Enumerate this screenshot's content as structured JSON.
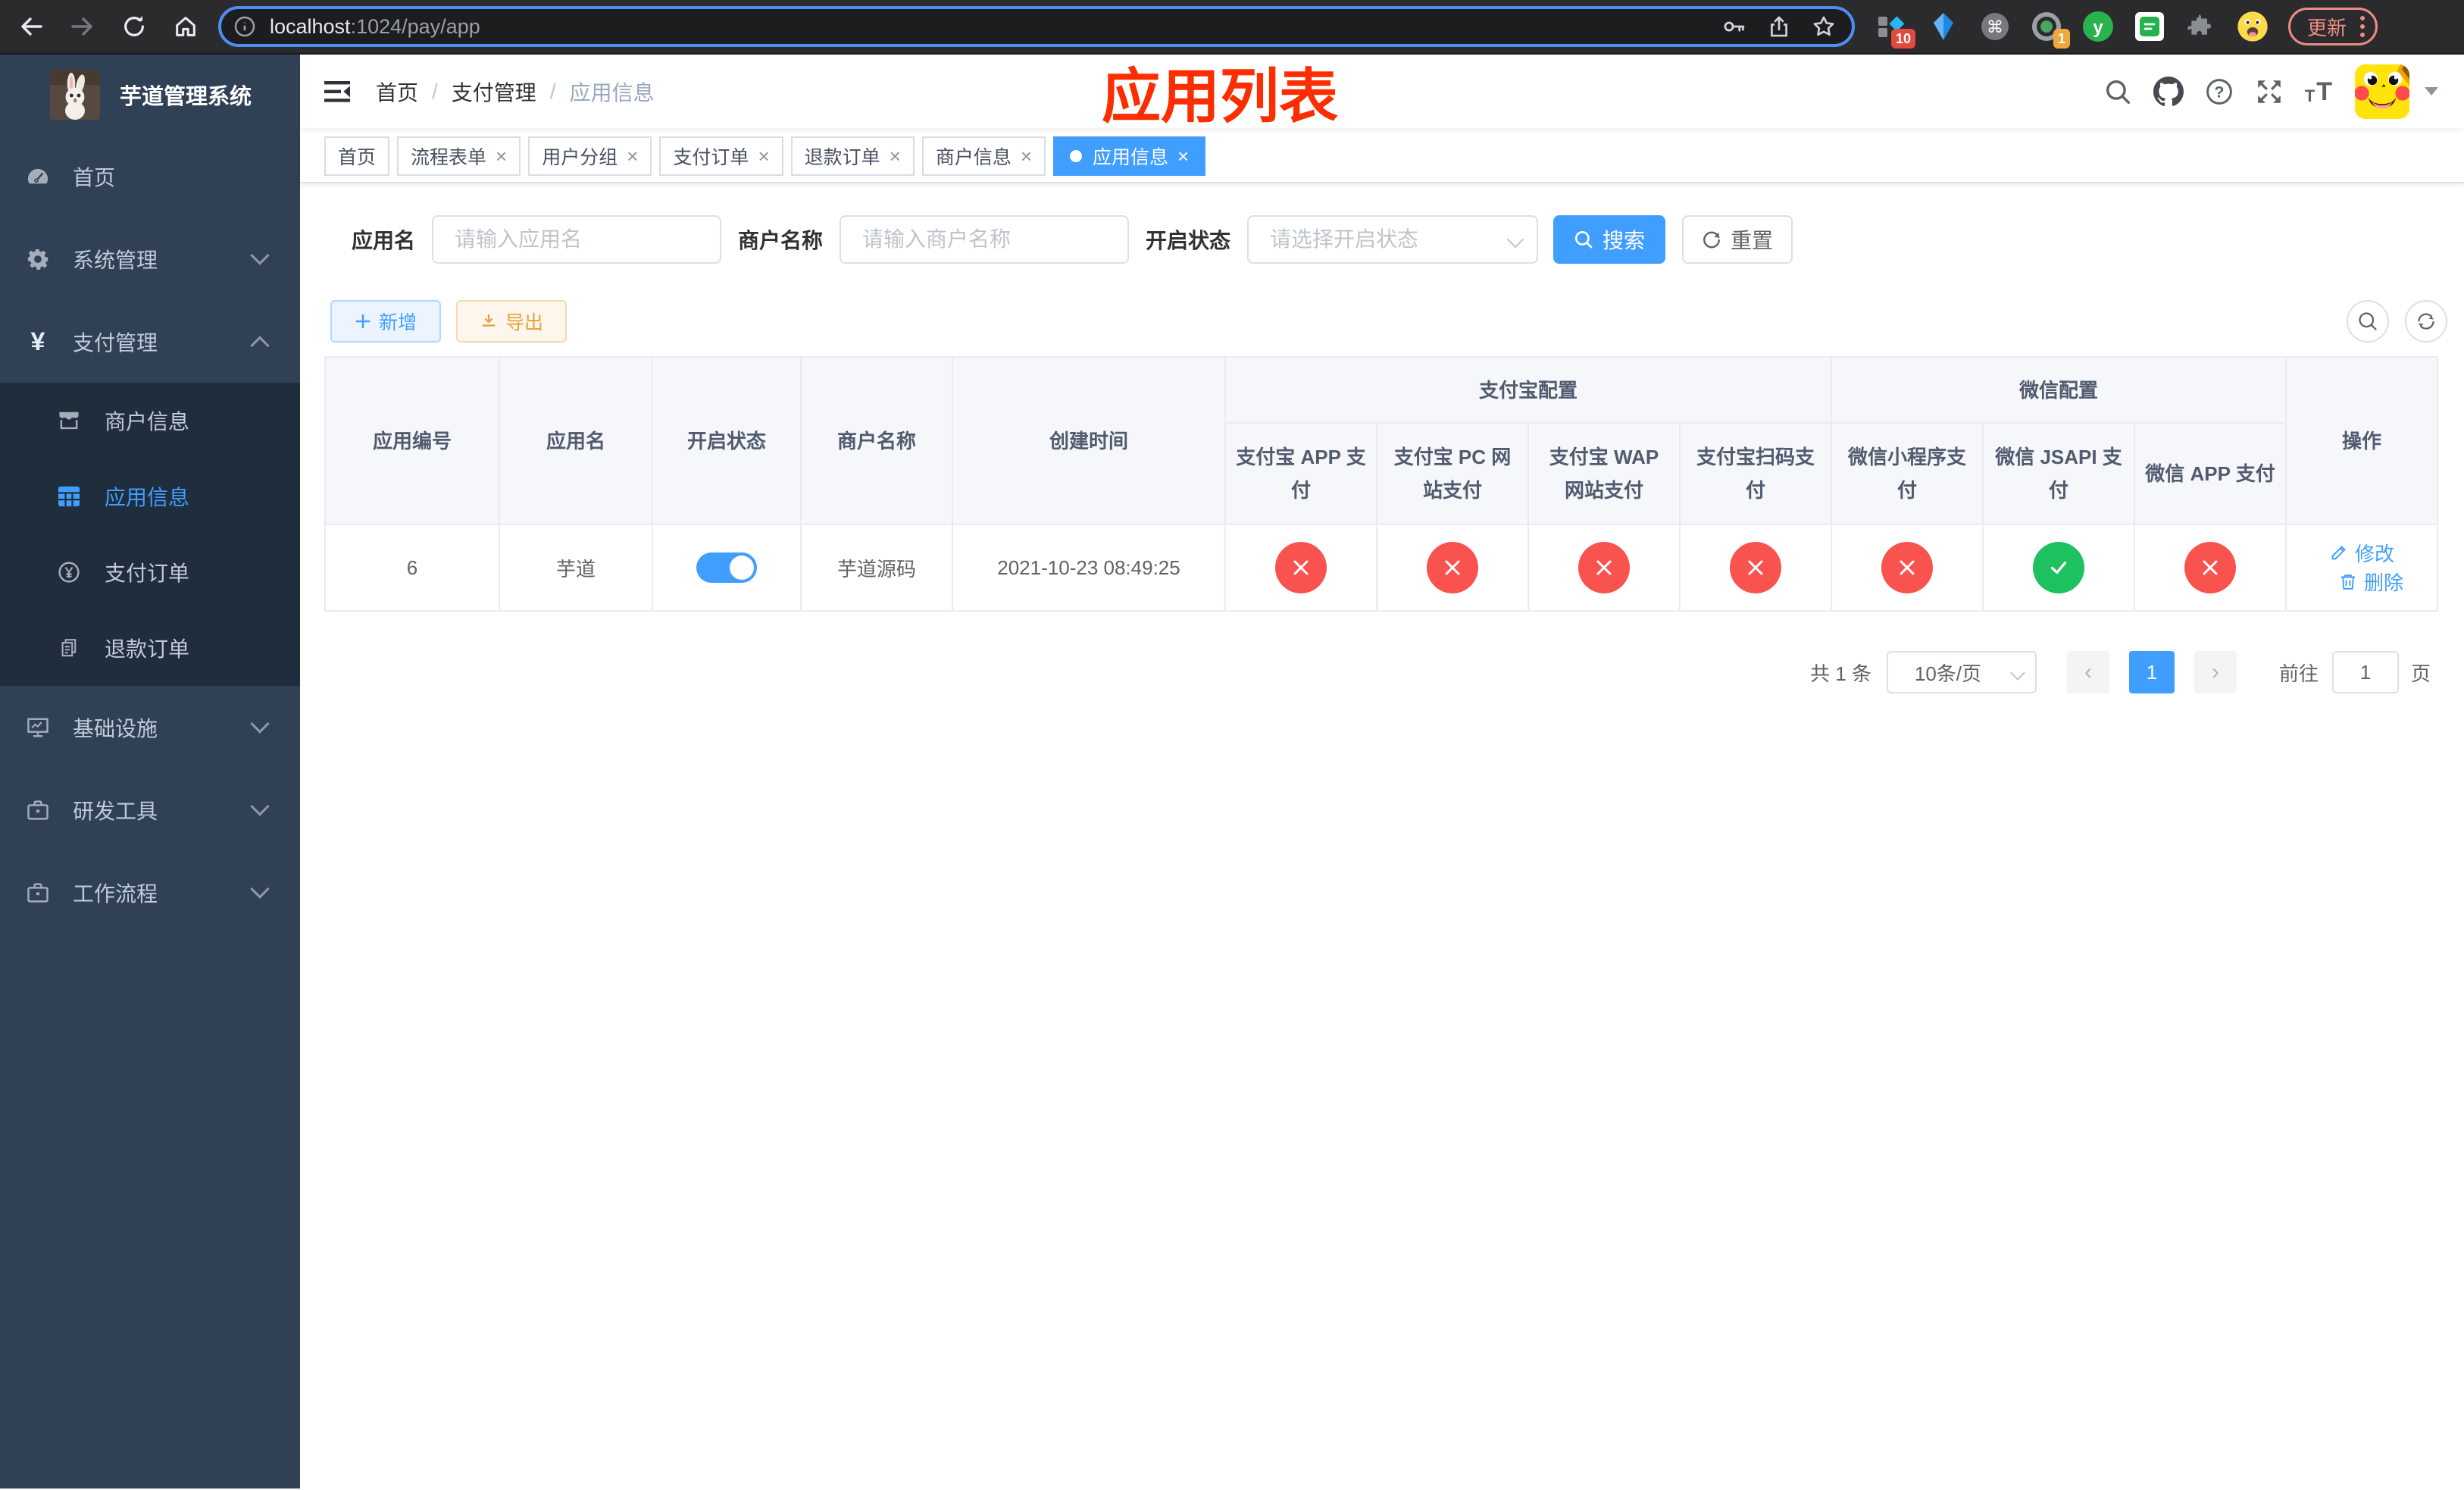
{
  "browser": {
    "url": {
      "host": "localhost",
      "path": ":1024/pay/app"
    },
    "extension_badge_1": "10",
    "extension_badge_2": "1",
    "update_label": "更新"
  },
  "sidebar": {
    "logo_title": "芋道管理系统",
    "menu": [
      {
        "label": "首页"
      },
      {
        "label": "系统管理"
      },
      {
        "label": "支付管理"
      },
      {
        "label": "商户信息"
      },
      {
        "label": "应用信息"
      },
      {
        "label": "支付订单"
      },
      {
        "label": "退款订单"
      },
      {
        "label": "基础设施"
      },
      {
        "label": "研发工具"
      },
      {
        "label": "工作流程"
      }
    ]
  },
  "navbar": {
    "breadcrumb": [
      "首页",
      "支付管理",
      "应用信息"
    ],
    "annotation": "应用列表"
  },
  "tabs": [
    {
      "label": "首页",
      "closable": false,
      "active": false
    },
    {
      "label": "流程表单",
      "closable": true,
      "active": false
    },
    {
      "label": "用户分组",
      "closable": true,
      "active": false
    },
    {
      "label": "支付订单",
      "closable": true,
      "active": false
    },
    {
      "label": "退款订单",
      "closable": true,
      "active": false
    },
    {
      "label": "商户信息",
      "closable": true,
      "active": false
    },
    {
      "label": "应用信息",
      "closable": true,
      "active": true
    }
  ],
  "filter": {
    "app_name": {
      "label": "应用名",
      "placeholder": "请输入应用名",
      "value": ""
    },
    "merchant_name": {
      "label": "商户名称",
      "placeholder": "请输入商户名称",
      "value": ""
    },
    "status": {
      "label": "开启状态",
      "placeholder": "请选择开启状态",
      "value": ""
    },
    "search_label": "搜索",
    "reset_label": "重置"
  },
  "actions": {
    "add_label": "新增",
    "export_label": "导出"
  },
  "table": {
    "columns": [
      "应用编号",
      "应用名",
      "开启状态",
      "商户名称",
      "创建时间"
    ],
    "groups": {
      "alipay": "支付宝配置",
      "wechat": "微信配置"
    },
    "pay_columns": [
      "支付宝 APP 支付",
      "支付宝 PC 网站支付",
      "支付宝 WAP 网站支付",
      "支付宝扫码支付",
      "微信小程序支付",
      "微信 JSAPI 支付",
      "微信 APP 支付"
    ],
    "op_column": "操作",
    "rows": [
      {
        "id": "6",
        "name": "芋道",
        "enabled": true,
        "merchant_name": "芋道源码",
        "create_time": "2021-10-23 08:49:25",
        "pay_status": [
          "disabled",
          "disabled",
          "disabled",
          "disabled",
          "disabled",
          "enabled",
          "disabled"
        ],
        "op_edit": "修改",
        "op_delete": "删除"
      }
    ]
  },
  "pagination": {
    "total_text": "共 1 条",
    "page_size_text": "10条/页",
    "current_page": "1",
    "goto_text": "前往",
    "goto_value": "1",
    "page_unit": "页"
  },
  "colors": {
    "primary": "#409eff",
    "success": "#1dc160",
    "danger": "#f9534f",
    "annotation_red": "#fc2d00"
  }
}
